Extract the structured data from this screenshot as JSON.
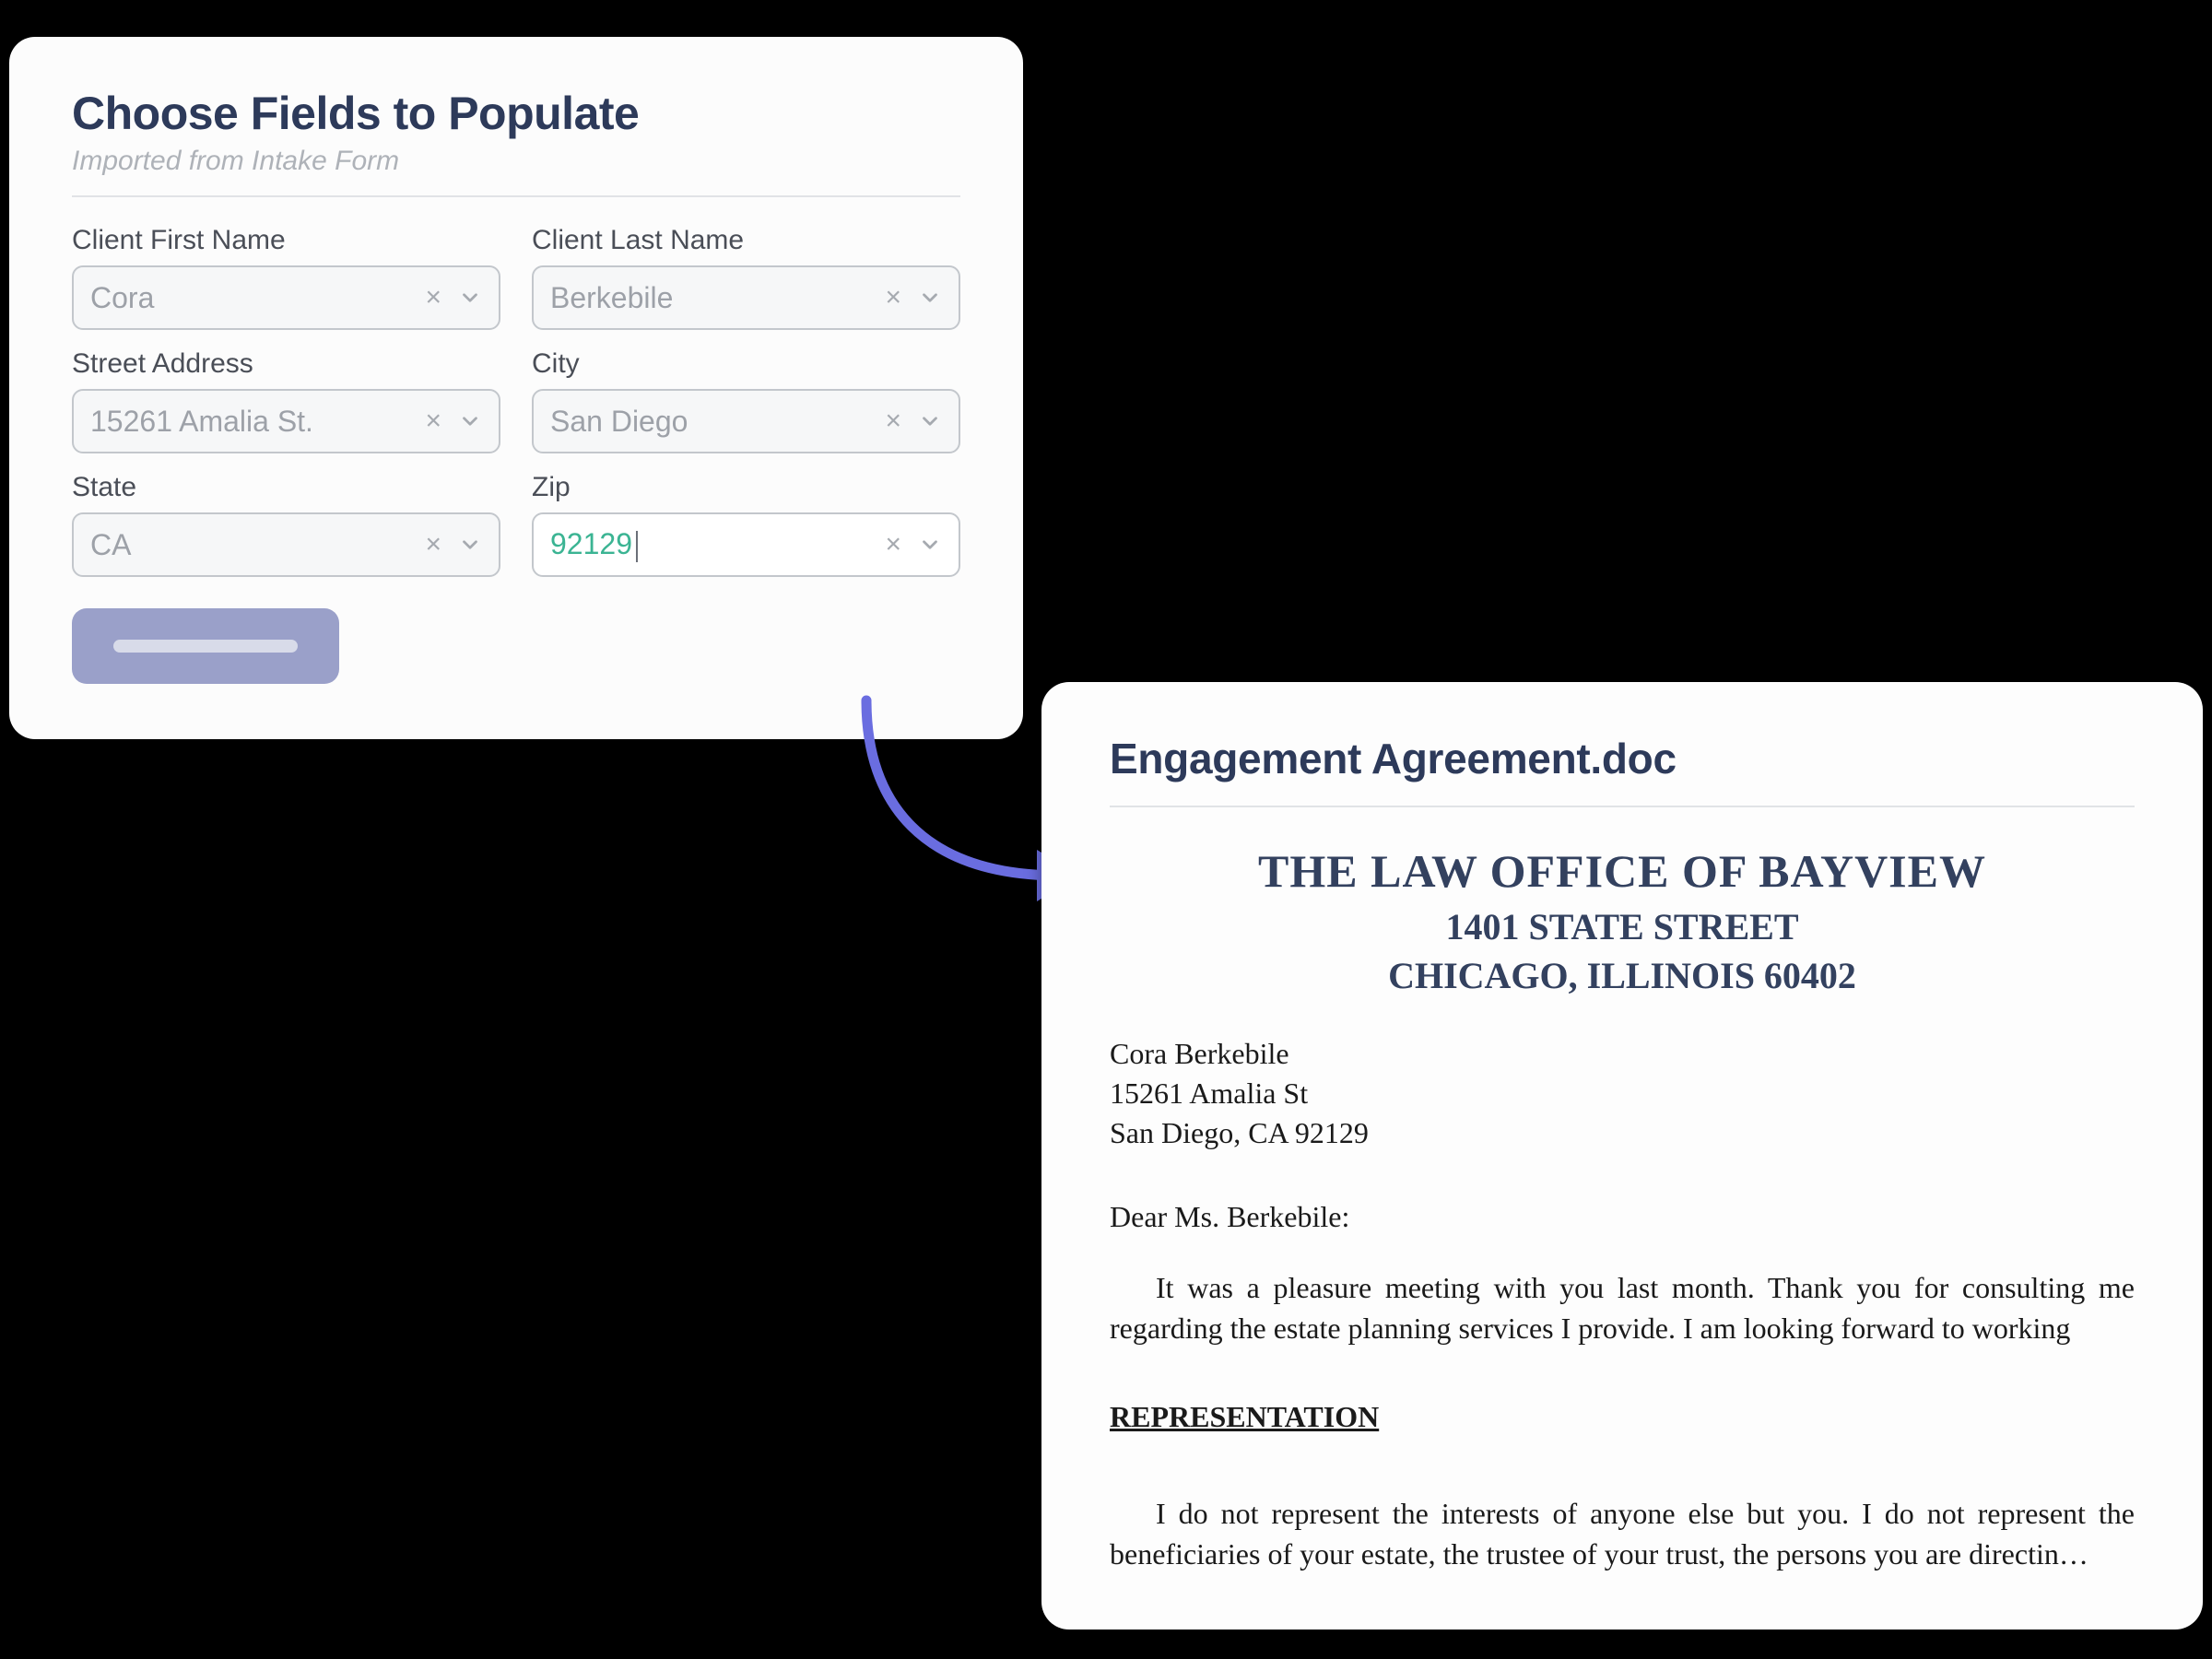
{
  "form": {
    "title": "Choose Fields to Populate",
    "subtitle": "Imported from Intake Form",
    "fields": {
      "firstName": {
        "label": "Client First Name",
        "value": "Cora"
      },
      "lastName": {
        "label": "Client Last Name",
        "value": "Berkebile"
      },
      "street": {
        "label": "Street Address",
        "value": "15261 Amalia St."
      },
      "city": {
        "label": "City",
        "value": "San Diego"
      },
      "state": {
        "label": "State",
        "value": "CA"
      },
      "zip": {
        "label": "Zip",
        "value": "92129"
      }
    }
  },
  "document": {
    "filename": "Engagement Agreement.doc",
    "letterhead": {
      "firm": "THE LAW OFFICE OF BAYVIEW",
      "street": "1401 STATE STREET",
      "cityline": "CHICAGO, ILLINOIS 60402"
    },
    "recipient": {
      "name": "Cora Berkebile",
      "street": "15261 Amalia St",
      "cityline": "San Diego, CA 92129"
    },
    "salutation": "Dear Ms. Berkebile:",
    "para1": "It was a pleasure meeting with you last month. Thank you for consulting me regarding the estate planning services I provide. I am looking forward to working",
    "sectionHeading": "REPRESENTATION",
    "para2": "I do not represent the interests of anyone else but you. I do not represent the beneficiaries of your estate, the trustee of your trust, the persons you are directin…"
  }
}
